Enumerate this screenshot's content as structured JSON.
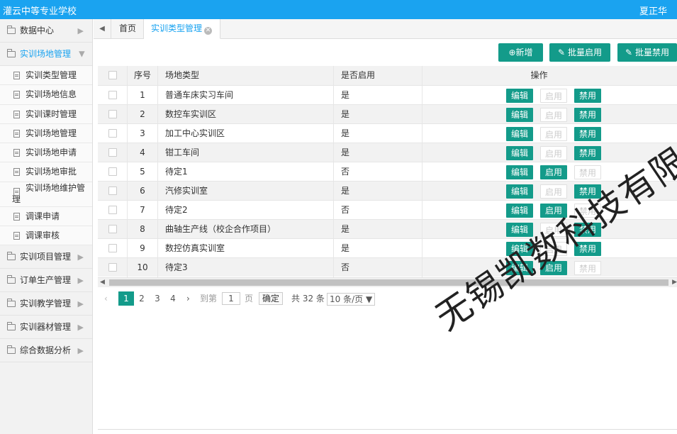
{
  "header": {
    "app_title": "灌云中等专业学校",
    "user_name": "夏正华"
  },
  "sidebar": {
    "groups": [
      {
        "label": "数据中心"
      },
      {
        "label": "实训场地管理"
      },
      {
        "label": "实训项目管理"
      },
      {
        "label": "订单生产管理"
      },
      {
        "label": "实训教学管理"
      },
      {
        "label": "实训器材管理"
      },
      {
        "label": "综合数据分析"
      }
    ],
    "sub_items": [
      {
        "label": "实训类型管理"
      },
      {
        "label": "实训场地信息"
      },
      {
        "label": "实训课时管理"
      },
      {
        "label": "实训场地管理"
      },
      {
        "label": "实训场地申请"
      },
      {
        "label": "实训场地审批"
      },
      {
        "label": "实训场地维护管理"
      },
      {
        "label": "调课申请"
      },
      {
        "label": "调课审核"
      }
    ]
  },
  "tabs": {
    "nav": "◀",
    "home": "首页",
    "active": "实训类型管理"
  },
  "toolbar": {
    "add": "新增",
    "batch_enable": "批量启用",
    "batch_disable": "批量禁用"
  },
  "table": {
    "headers": {
      "no": "序号",
      "type": "场地类型",
      "enabled": "是否启用",
      "ops": "操作"
    },
    "op_labels": {
      "edit": "编辑",
      "enable": "启用",
      "disable": "禁用"
    },
    "rows": [
      {
        "no": "1",
        "type": "普通车床实习车间",
        "enabled": "是"
      },
      {
        "no": "2",
        "type": "数控车实训区",
        "enabled": "是"
      },
      {
        "no": "3",
        "type": "加工中心实训区",
        "enabled": "是"
      },
      {
        "no": "4",
        "type": "钳工车间",
        "enabled": "是"
      },
      {
        "no": "5",
        "type": "待定1",
        "enabled": "否"
      },
      {
        "no": "6",
        "type": "汽修实训室",
        "enabled": "是"
      },
      {
        "no": "7",
        "type": "待定2",
        "enabled": "否"
      },
      {
        "no": "8",
        "type": "曲轴生产线（校企合作项目）",
        "enabled": "是"
      },
      {
        "no": "9",
        "type": "数控仿真实训室",
        "enabled": "是"
      },
      {
        "no": "10",
        "type": "待定3",
        "enabled": "否"
      }
    ]
  },
  "pagination": {
    "prev": "‹",
    "pages": [
      "1",
      "2",
      "3",
      "4"
    ],
    "next": "›",
    "goto_label": "到第",
    "goto_value": "1",
    "page_unit": "页",
    "confirm": "确定",
    "total": "共 32 条",
    "page_size": "10 条/页"
  },
  "watermark": "无锡凯数科技有限公司",
  "colors": {
    "brand": "#1aa3f0",
    "button": "#139b8a"
  }
}
